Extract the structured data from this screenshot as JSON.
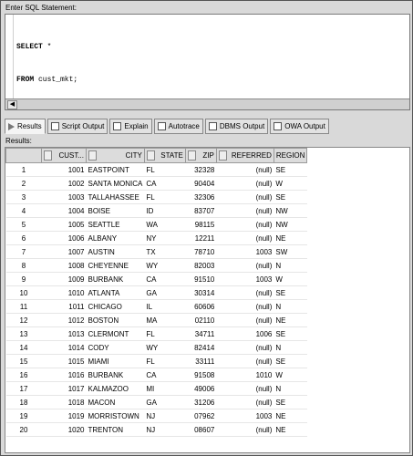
{
  "sql_label": "Enter SQL Statement:",
  "sql_lines": [
    {
      "kw": "SELECT",
      "rest": " *"
    },
    {
      "kw": "FROM",
      "rest": " cust_mkt;"
    }
  ],
  "tabs": [
    {
      "label": "Results",
      "icon": "results-icon",
      "active": true
    },
    {
      "label": "Script Output",
      "icon": "script-output-icon"
    },
    {
      "label": "Explain",
      "icon": "explain-icon"
    },
    {
      "label": "Autotrace",
      "icon": "autotrace-icon"
    },
    {
      "label": "DBMS Output",
      "icon": "dbms-output-icon"
    },
    {
      "label": "OWA Output",
      "icon": "owa-output-icon"
    }
  ],
  "results_label": "Results:",
  "columns": [
    "CUST...",
    "CITY",
    "STATE",
    "ZIP",
    "REFERRED",
    "REGION"
  ],
  "rows": [
    [
      "1",
      "1001",
      "EASTPOINT",
      "FL",
      "32328",
      "(null)",
      "SE"
    ],
    [
      "2",
      "1002",
      "SANTA MONICA",
      "CA",
      "90404",
      "(null)",
      "W"
    ],
    [
      "3",
      "1003",
      "TALLAHASSEE",
      "FL",
      "32306",
      "(null)",
      "SE"
    ],
    [
      "4",
      "1004",
      "BOISE",
      "ID",
      "83707",
      "(null)",
      "NW"
    ],
    [
      "5",
      "1005",
      "SEATTLE",
      "WA",
      "98115",
      "(null)",
      "NW"
    ],
    [
      "6",
      "1006",
      "ALBANY",
      "NY",
      "12211",
      "(null)",
      "NE"
    ],
    [
      "7",
      "1007",
      "AUSTIN",
      "TX",
      "78710",
      "1003",
      "SW"
    ],
    [
      "8",
      "1008",
      "CHEYENNE",
      "WY",
      "82003",
      "(null)",
      "N"
    ],
    [
      "9",
      "1009",
      "BURBANK",
      "CA",
      "91510",
      "1003",
      "W"
    ],
    [
      "10",
      "1010",
      "ATLANTA",
      "GA",
      "30314",
      "(null)",
      "SE"
    ],
    [
      "11",
      "1011",
      "CHICAGO",
      "IL",
      "60606",
      "(null)",
      "N"
    ],
    [
      "12",
      "1012",
      "BOSTON",
      "MA",
      "02110",
      "(null)",
      "NE"
    ],
    [
      "13",
      "1013",
      "CLERMONT",
      "FL",
      "34711",
      "1006",
      "SE"
    ],
    [
      "14",
      "1014",
      "CODY",
      "WY",
      "82414",
      "(null)",
      "N"
    ],
    [
      "15",
      "1015",
      "MIAMI",
      "FL",
      "33111",
      "(null)",
      "SE"
    ],
    [
      "16",
      "1016",
      "BURBANK",
      "CA",
      "91508",
      "1010",
      "W"
    ],
    [
      "17",
      "1017",
      "KALMAZOO",
      "MI",
      "49006",
      "(null)",
      "N"
    ],
    [
      "18",
      "1018",
      "MACON",
      "GA",
      "31206",
      "(null)",
      "SE"
    ],
    [
      "19",
      "1019",
      "MORRISTOWN",
      "NJ",
      "07962",
      "1003",
      "NE"
    ],
    [
      "20",
      "1020",
      "TRENTON",
      "NJ",
      "08607",
      "(null)",
      "NE"
    ]
  ]
}
